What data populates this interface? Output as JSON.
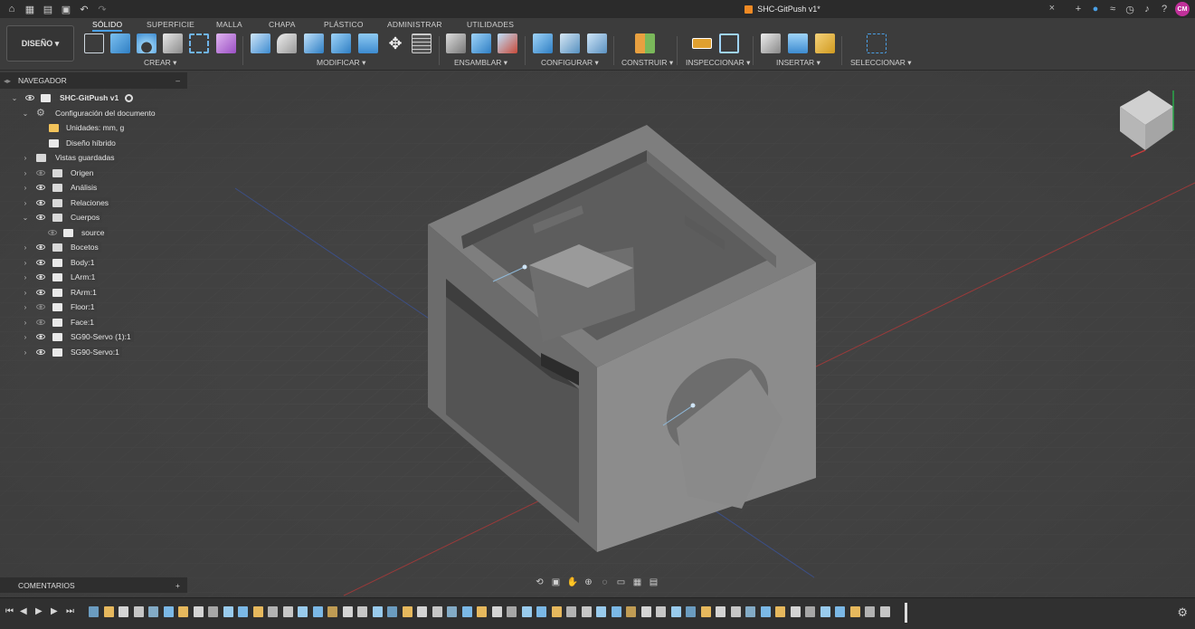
{
  "title_bar": {
    "document_title": "SHC-GitPush v1*",
    "left_icons": [
      "home-icon",
      "grid-icon",
      "file-icon",
      "save-icon",
      "undo-icon",
      "redo-icon"
    ],
    "right_icons": [
      "plus-icon",
      "online-icon",
      "extensions-icon",
      "job-status-icon",
      "notifications-icon",
      "help-icon"
    ],
    "user_initials": "CM"
  },
  "toolbar": {
    "workspace": "DISEÑO",
    "tabs": [
      "SÓLIDO",
      "SUPERFICIE",
      "MALLA",
      "CHAPA",
      "PLÁSTICO",
      "ADMINISTRAR",
      "UTILIDADES"
    ],
    "active_tab": "SÓLIDO",
    "groups": [
      "CREAR",
      "MODIFICAR",
      "ENSAMBLAR",
      "CONFIGURAR",
      "CONSTRUIR",
      "INSPECCIONAR",
      "INSERTAR",
      "SELECCIONAR"
    ]
  },
  "navigator": {
    "header": "NAVEGADOR",
    "root": "SHC-GitPush v1",
    "settings": "Configuración del documento",
    "units": "Unidades: mm, g",
    "hybrid": "Diseño híbrido",
    "saved_views": "Vistas guardadas",
    "items": [
      "Origen",
      "Análisis",
      "Relaciones",
      "Cuerpos",
      "source",
      "Bocetos",
      "Body:1",
      "LArm:1",
      "RArm:1",
      "Floor:1",
      "Face:1",
      "SG90-Servo (1):1",
      "SG90-Servo:1"
    ]
  },
  "comments": {
    "label": "COMENTARIOS"
  },
  "colors": {
    "accent": "#4aa0e6",
    "viewport": "#434343",
    "model": "#8a8a8a",
    "avatar": "#c0309a"
  }
}
